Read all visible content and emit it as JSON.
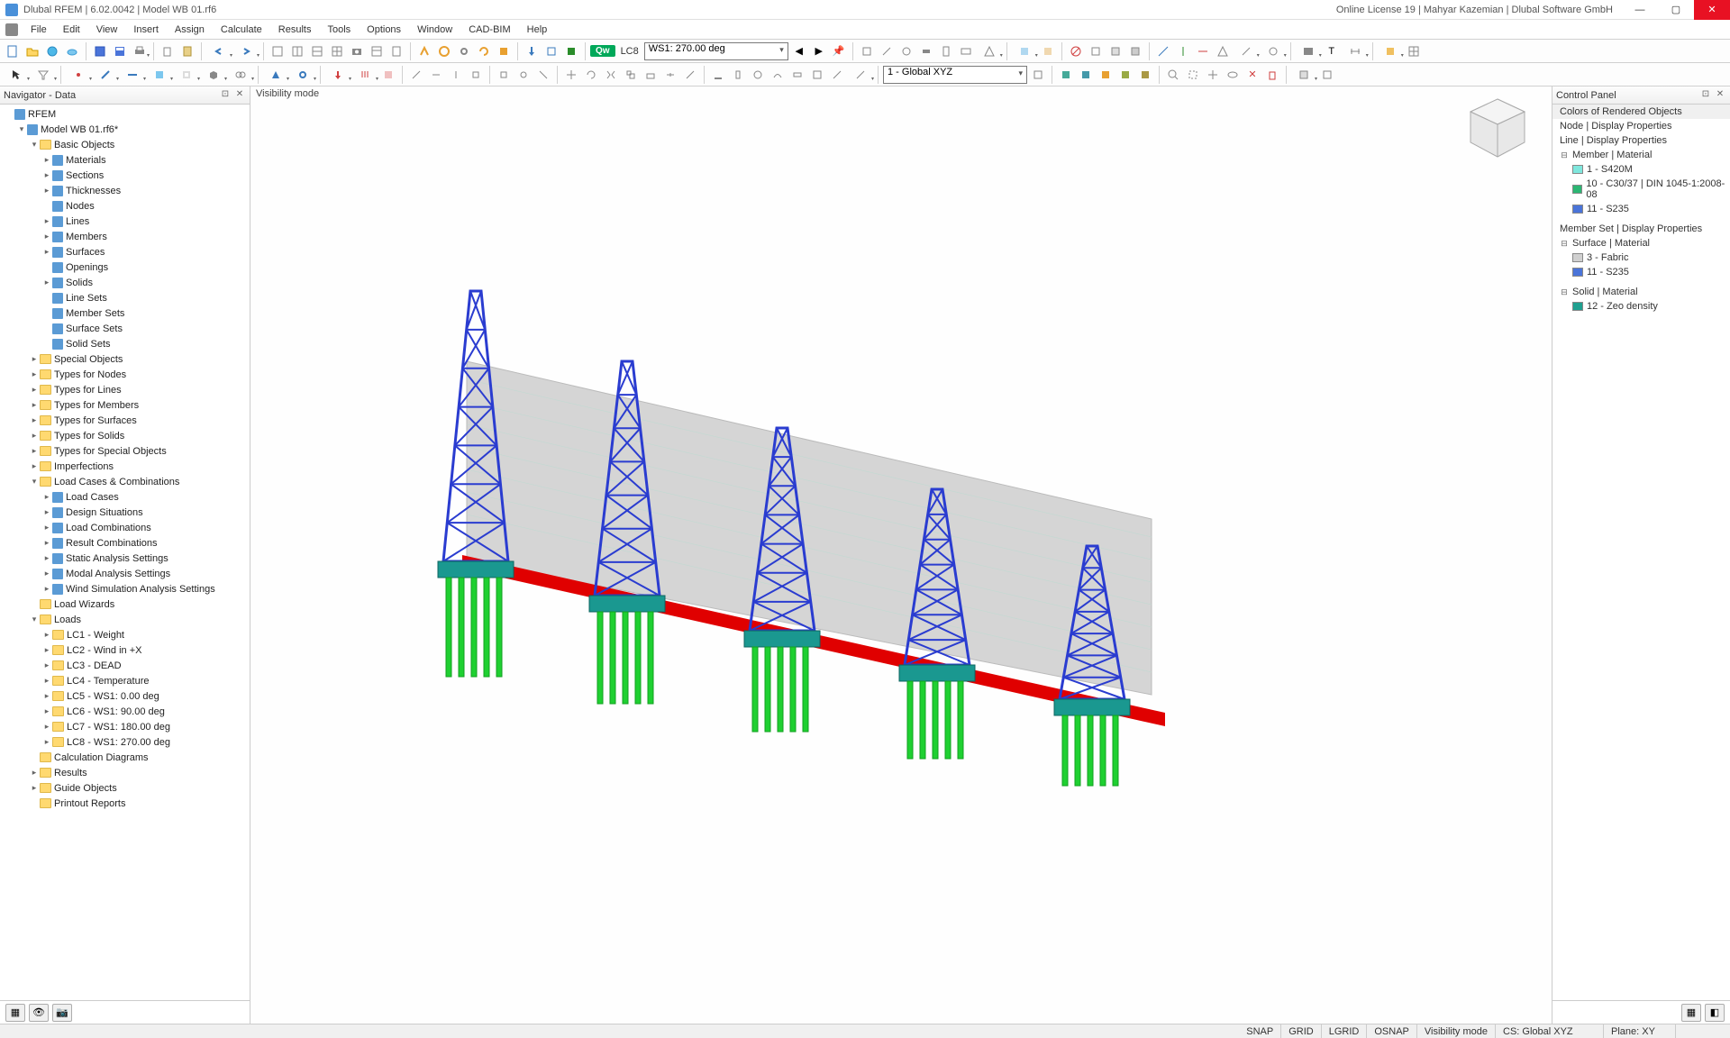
{
  "title": "Dlubal RFEM | 6.02.0042 | Model WB 01.rf6",
  "license": "Online License 19 | Mahyar Kazemian | Dlubal Software GmbH",
  "menu": [
    "File",
    "Edit",
    "View",
    "Insert",
    "Assign",
    "Calculate",
    "Results",
    "Tools",
    "Options",
    "Window",
    "CAD-BIM",
    "Help"
  ],
  "toolbar1": {
    "qw": "Qw",
    "lc": "LC8",
    "combo": "WS1: 270.00 deg"
  },
  "toolbar2": {
    "cs": "1 - Global XYZ"
  },
  "navigator": {
    "title": "Navigator - Data",
    "root": "RFEM",
    "model": "Model WB 01.rf6*",
    "basic_objects": "Basic Objects",
    "basic": [
      "Materials",
      "Sections",
      "Thicknesses",
      "Nodes",
      "Lines",
      "Members",
      "Surfaces",
      "Openings",
      "Solids",
      "Line Sets",
      "Member Sets",
      "Surface Sets",
      "Solid Sets"
    ],
    "groups1": [
      "Special Objects",
      "Types for Nodes",
      "Types for Lines",
      "Types for Members",
      "Types for Surfaces",
      "Types for Solids",
      "Types for Special Objects",
      "Imperfections"
    ],
    "lcc": "Load Cases & Combinations",
    "lcc_items": [
      "Load Cases",
      "Design Situations",
      "Load Combinations",
      "Result Combinations",
      "Static Analysis Settings",
      "Modal Analysis Settings",
      "Wind Simulation Analysis Settings"
    ],
    "load_wizards": "Load Wizards",
    "loads": "Loads",
    "load_items": [
      "LC1 - Weight",
      "LC2 - Wind in +X",
      "LC3 - DEAD",
      "LC4 - Temperature",
      "LC5 - WS1: 0.00 deg",
      "LC6 - WS1: 90.00 deg",
      "LC7 - WS1: 180.00 deg",
      "LC8 - WS1: 270.00 deg"
    ],
    "bottom": [
      "Calculation Diagrams",
      "Results",
      "Guide Objects",
      "Printout Reports"
    ]
  },
  "viewport_label": "Visibility mode",
  "control_panel": {
    "title": "Control Panel",
    "header": "Colors of Rendered Objects",
    "node_disp": "Node | Display Properties",
    "line_disp": "Line | Display Properties",
    "member_mat": "Member | Material",
    "members": [
      {
        "c": "#7fe7dd",
        "t": "1 - S420M"
      },
      {
        "c": "#2bb673",
        "t": "10 - C30/37 | DIN 1045-1:2008-08"
      },
      {
        "c": "#4a74d9",
        "t": "11 - S235"
      }
    ],
    "memberset": "Member Set | Display Properties",
    "surface_mat": "Surface | Material",
    "surfaces": [
      {
        "c": "#d0d0d0",
        "t": "3 - Fabric"
      },
      {
        "c": "#4a74d9",
        "t": "11 - S235"
      }
    ],
    "solid_mat": "Solid | Material",
    "solids": [
      {
        "c": "#1fa090",
        "t": "12 - Zeo density"
      }
    ]
  },
  "status": {
    "snap": "SNAP",
    "grid": "GRID",
    "lgrid": "LGRID",
    "osnap": "OSNAP",
    "vis": "Visibility mode",
    "cs": "CS: Global XYZ",
    "plane": "Plane: XY"
  }
}
